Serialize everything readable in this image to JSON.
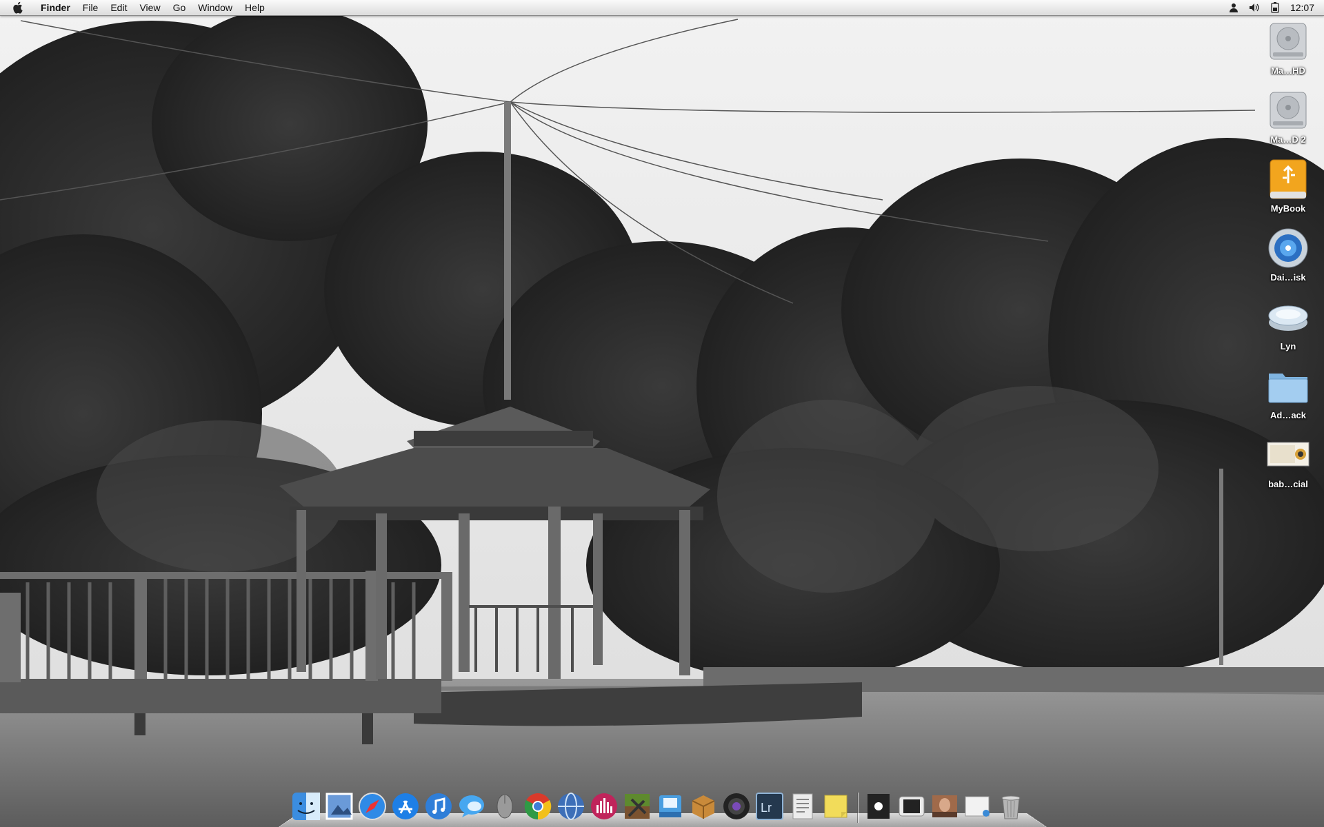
{
  "menubar": {
    "apple_icon": "apple-logo-icon",
    "app_name": "Finder",
    "menus": [
      "File",
      "Edit",
      "View",
      "Go",
      "Window",
      "Help"
    ],
    "status_icons": [
      "user-icon",
      "volume-icon",
      "battery-icon"
    ],
    "clock": "12:07"
  },
  "desktop_icons": [
    {
      "label": "Ma…HD",
      "icon": "hard-drive-icon"
    },
    {
      "label": "Ma…D 2",
      "icon": "hard-drive-icon"
    },
    {
      "label": "MyBook",
      "icon": "external-usb-drive-icon"
    },
    {
      "label": "Dai…isk",
      "icon": "disk-image-icon"
    },
    {
      "label": "Lyn",
      "icon": "removable-disk-icon"
    },
    {
      "label": "Ad…ack",
      "icon": "folder-icon"
    },
    {
      "label": "bab…cial",
      "icon": "image-file-icon"
    }
  ],
  "dock": {
    "apps": [
      {
        "name": "finder-icon",
        "color": "#3b8de0"
      },
      {
        "name": "preview-icon",
        "color": "#6a9ad8"
      },
      {
        "name": "safari-icon",
        "color": "#2f8ae6"
      },
      {
        "name": "app-store-icon",
        "color": "#1e7fe6"
      },
      {
        "name": "itunes-icon",
        "color": "#2f7ed8"
      },
      {
        "name": "messages-icon",
        "color": "#47a7f0"
      },
      {
        "name": "mouse-icon",
        "color": "#9a9a9a"
      },
      {
        "name": "chrome-icon",
        "color": "#d93a2b"
      },
      {
        "name": "globe-icon",
        "color": "#3d6fb8"
      },
      {
        "name": "audio-equalizer-icon",
        "color": "#c0245b"
      },
      {
        "name": "minecraft-icon",
        "color": "#5e8a2e"
      },
      {
        "name": "installer-disk-icon",
        "color": "#4a9ee0"
      },
      {
        "name": "package-box-icon",
        "color": "#c98a3a"
      },
      {
        "name": "camera-lens-icon",
        "color": "#222222"
      },
      {
        "name": "lightroom-icon",
        "color": "#24384e"
      },
      {
        "name": "textedit-icon",
        "color": "#ececec"
      },
      {
        "name": "stickies-icon",
        "color": "#f2dc5a"
      }
    ],
    "stacks": [
      {
        "name": "apple-stack-icon",
        "color": "#222222"
      },
      {
        "name": "iphone-stack-icon",
        "color": "#eaeaea"
      },
      {
        "name": "photo-stack-icon",
        "color": "#a06a4a"
      },
      {
        "name": "documents-stack-icon",
        "color": "#f2f2f2"
      },
      {
        "name": "trash-icon",
        "color": "#b5b5b5"
      }
    ]
  }
}
